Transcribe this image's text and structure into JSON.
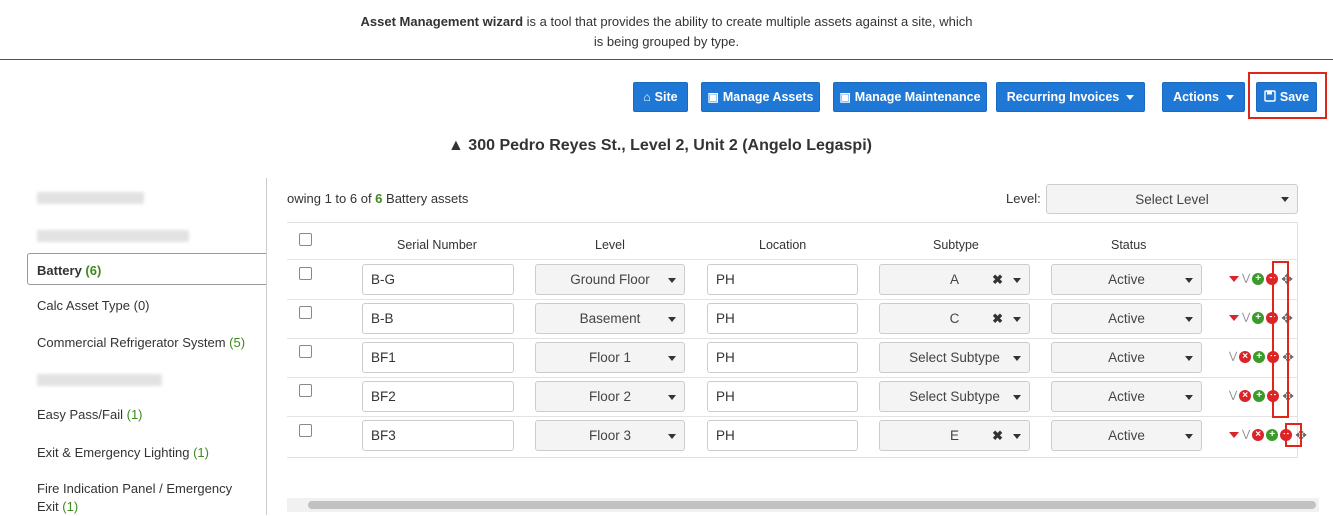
{
  "intro": {
    "bold": "Asset Management wizard",
    "line1_rest": " is a tool that provides the ability to create multiple assets against a site, which",
    "line2": "is being grouped by type."
  },
  "toolbar": {
    "site": {
      "label": "Site",
      "icon": "home-icon"
    },
    "manage_assets": {
      "label": "Manage Assets",
      "icon": "briefcase-icon"
    },
    "manage_maintenance": {
      "label": "Manage Maintenance",
      "icon": "briefcase-icon"
    },
    "recurring_invoices": {
      "label": "Recurring Invoices",
      "icon": "caret-down-icon"
    },
    "actions": {
      "label": "Actions",
      "icon": "caret-down-icon"
    },
    "save": {
      "label": "Save",
      "icon": "floppy-disk-icon"
    }
  },
  "page_title": {
    "icon": "road-icon",
    "text": "300 Pedro Reyes St., Level 2, Unit 2 (Angelo Legaspi)"
  },
  "sidebar": {
    "items": [
      {
        "label": "Battery",
        "count": "(6)",
        "active": true
      },
      {
        "label": "Calc Asset Type",
        "count": "(0)"
      },
      {
        "label": "Commercial Refrigerator System",
        "count": "(5)"
      },
      {
        "label": "Easy Pass/Fail",
        "count": "(1)"
      },
      {
        "label": "Exit & Emergency Lighting",
        "count": "(1)"
      },
      {
        "label": "Fire Indication Panel / Emergency",
        "label2": "Exit",
        "count": "(1)"
      }
    ]
  },
  "listing": {
    "prefix": "owing 1 to 6 of ",
    "count": "6",
    "suffix": " Battery assets"
  },
  "level_filter": {
    "label": "Level:",
    "placeholder": "Select Level"
  },
  "table": {
    "headers": [
      "Serial Number",
      "Level",
      "Location",
      "Subtype",
      "Status"
    ],
    "rows": [
      {
        "serial": "B-G",
        "level": "Ground Floor",
        "location": "PH",
        "subtype": "A",
        "status": "Active"
      },
      {
        "serial": "B-B",
        "level": "Basement",
        "location": "PH",
        "subtype": "C",
        "status": "Active"
      },
      {
        "serial": "BF1",
        "level": "Floor 1",
        "location": "PH",
        "subtype": "Select Subtype",
        "status": "Active"
      },
      {
        "serial": "BF2",
        "level": "Floor 2",
        "location": "PH",
        "subtype": "Select Subtype",
        "status": "Active"
      },
      {
        "serial": "BF3",
        "level": "Floor 3",
        "location": "PH",
        "subtype": "E",
        "status": "Active"
      }
    ]
  },
  "colors": {
    "primary": "#1f78d6",
    "highlight": "#e0251b",
    "count_green": "#3c8a1e"
  }
}
